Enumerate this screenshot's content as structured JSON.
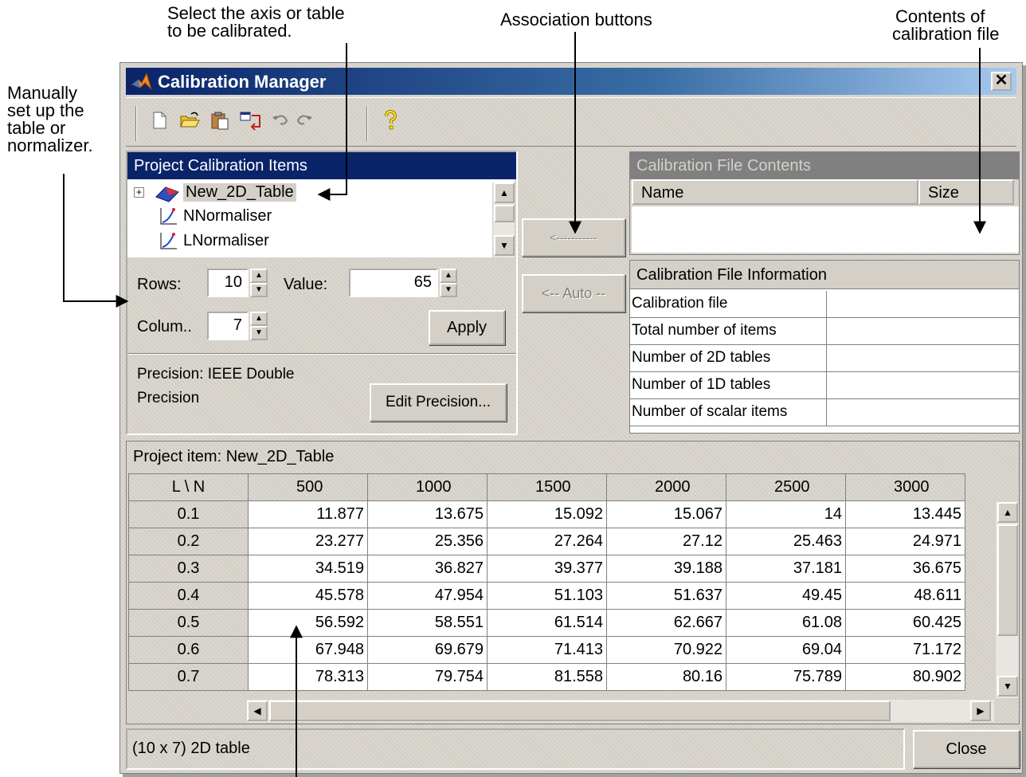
{
  "annotations": {
    "manual_setup": [
      "Manually",
      "set up the",
      "table or",
      "normalizer."
    ],
    "select_axis": [
      "Select the axis or table",
      "to be calibrated."
    ],
    "association": [
      "Association buttons"
    ],
    "contents": [
      "Contents of",
      "calibration file"
    ]
  },
  "window": {
    "title": "Calibration Manager",
    "close_glyph": "✕"
  },
  "toolbar": {
    "icons": [
      "new-icon",
      "open-icon",
      "paste-icon",
      "associate-icon",
      "undo-icon",
      "redo-icon",
      "help-icon"
    ]
  },
  "left_panel": {
    "header": "Project Calibration Items",
    "tree": [
      {
        "label": "New_2D_Table",
        "selected": true
      },
      {
        "label": "NNormaliser",
        "selected": false
      },
      {
        "label": "LNormaliser",
        "selected": false
      }
    ],
    "rows_label": "Rows:",
    "rows_value": "10",
    "value_label": "Value:",
    "value_value": "65",
    "columns_label": "Colum..",
    "columns_value": "7",
    "apply_label": "Apply",
    "precision_text_1": "Precision: IEEE Double",
    "precision_text_2": "Precision",
    "edit_precision_label": "Edit Precision..."
  },
  "middle": {
    "assoc_button_label": "<-----------",
    "auto_button_label": "<-- Auto --"
  },
  "file_contents": {
    "header": "Calibration File Contents",
    "col_name": "Name",
    "col_size": "Size"
  },
  "file_info": {
    "header": "Calibration File Information",
    "rows": [
      "Calibration file",
      "Total number of items",
      "Number of 2D tables",
      "Number of 1D tables",
      "Number of scalar items"
    ]
  },
  "grid": {
    "title": "Project item: New_2D_Table",
    "corner": "L \\ N",
    "columns": [
      "500",
      "1000",
      "1500",
      "2000",
      "2500",
      "3000"
    ],
    "rows": [
      {
        "h": "0.1",
        "v": [
          "11.877",
          "13.675",
          "15.092",
          "15.067",
          "14",
          "13.445"
        ]
      },
      {
        "h": "0.2",
        "v": [
          "23.277",
          "25.356",
          "27.264",
          "27.12",
          "25.463",
          "24.971"
        ]
      },
      {
        "h": "0.3",
        "v": [
          "34.519",
          "36.827",
          "39.377",
          "39.188",
          "37.181",
          "36.675"
        ]
      },
      {
        "h": "0.4",
        "v": [
          "45.578",
          "47.954",
          "51.103",
          "51.637",
          "49.45",
          "48.611"
        ]
      },
      {
        "h": "0.5",
        "v": [
          "56.592",
          "58.551",
          "61.514",
          "62.667",
          "61.08",
          "60.425"
        ]
      },
      {
        "h": "0.6",
        "v": [
          "67.948",
          "69.679",
          "71.413",
          "70.922",
          "69.04",
          "71.172"
        ]
      },
      {
        "h": "0.7",
        "v": [
          "78.313",
          "79.754",
          "81.558",
          "80.16",
          "75.789",
          "80.902"
        ]
      }
    ]
  },
  "status": {
    "text": "(10 x 7) 2D table",
    "close_label": "Close"
  }
}
